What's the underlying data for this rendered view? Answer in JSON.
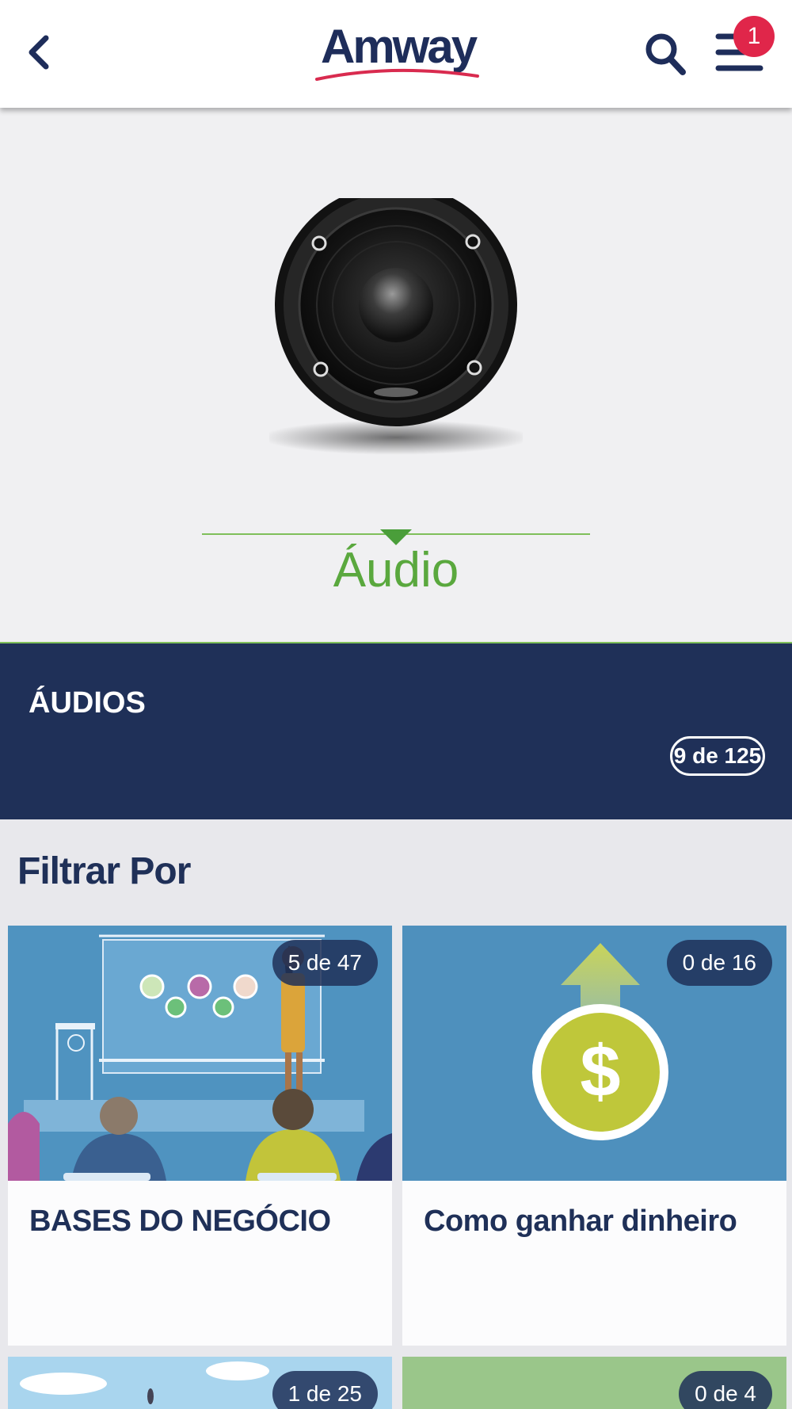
{
  "header": {
    "back_icon": "chevron-left-icon",
    "logo_text": "Amway",
    "search_icon": "search-icon",
    "menu_icon": "hamburger-menu-icon",
    "notification_count": "1"
  },
  "hero": {
    "image": "speaker-icon",
    "title": "Áudio"
  },
  "category": {
    "title": "ÁUDIOS",
    "progress": "9 de 125"
  },
  "filter": {
    "title": "Filtrar Por"
  },
  "cards": [
    {
      "title": "BASES DO NEGÓCIO",
      "progress": "5 de 47",
      "image": "presentation-illustration"
    },
    {
      "title": "Como ganhar dinheiro",
      "progress": "0 de 16",
      "image": "dollar-coin-illustration"
    },
    {
      "title": "",
      "progress": "1 de 25",
      "image": "sky-illustration"
    },
    {
      "title": "",
      "progress": "0 de 4",
      "image": "green-illustration"
    }
  ],
  "colors": {
    "navy": "#1f3058",
    "accent_green": "#5aa83e",
    "badge_red": "#e0264a",
    "card_blue": "#4e90bd"
  }
}
